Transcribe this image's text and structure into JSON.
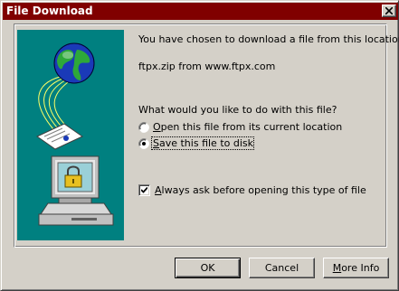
{
  "window": {
    "title": "File Download"
  },
  "message": {
    "intro": "You have chosen to download a file from this location.",
    "source": "ftpx.zip from www.ftpx.com",
    "question": "What would you like to do with this file?"
  },
  "options": {
    "open": {
      "mnemonic": "O",
      "rest": "pen this file from its current location",
      "selected": false
    },
    "save": {
      "mnemonic": "S",
      "rest": "ave this file to disk",
      "selected": true
    }
  },
  "always_ask": {
    "mnemonic": "A",
    "rest": "lways ask before opening this type of file",
    "checked": true
  },
  "buttons": {
    "ok": "OK",
    "cancel": "Cancel",
    "more_info_mnemonic": "M",
    "more_info_rest": "ore Info"
  },
  "colors": {
    "titlebar": "#800000",
    "illustration_bg": "#008080",
    "face": "#d4d0c8"
  },
  "icons": {
    "close": "close-icon",
    "globe": "globe-icon",
    "document": "document-icon",
    "computer": "computer-icon",
    "lock": "lock-icon"
  }
}
